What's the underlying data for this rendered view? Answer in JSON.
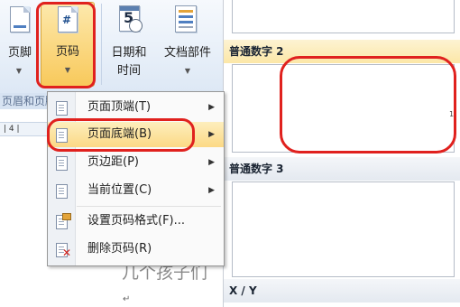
{
  "ribbon": {
    "buttons": [
      {
        "label": "页脚",
        "icon": "footer-icon"
      },
      {
        "label": "页码",
        "icon": "page-number-icon",
        "glyph": "#"
      },
      {
        "label_line1": "日期和",
        "label_line2": "时间",
        "icon": "calendar-clock-icon",
        "calendar_digit": "5"
      },
      {
        "label": "文档部件",
        "icon": "quick-parts-icon"
      }
    ],
    "group_label": "页眉和页脚",
    "ruler_text": "| 4 |"
  },
  "menu": {
    "items": [
      {
        "label": "页面顶端(T)",
        "submenu": true,
        "icon": "page-top-icon"
      },
      {
        "label": "页面底端(B)",
        "submenu": true,
        "icon": "page-bottom-icon"
      },
      {
        "label": "页边距(P)",
        "submenu": true,
        "icon": "page-margin-icon"
      },
      {
        "label": "当前位置(C)",
        "submenu": true,
        "icon": "current-position-icon"
      },
      {
        "label": "设置页码格式(F)...",
        "submenu": false,
        "icon": "format-page-number-icon"
      },
      {
        "label": "删除页码(R)",
        "submenu": false,
        "icon": "delete-page-number-icon"
      }
    ],
    "submenu_arrow": "▶",
    "active_index": 1
  },
  "gallery": {
    "item2_title": "普通数字 2",
    "item2_number": "1",
    "item3_title": "普通数字 3",
    "xy_title": "X / Y"
  },
  "document": {
    "background_text": "几个孩子们",
    "paragraph_mark": "↵"
  },
  "colors": {
    "annotation_red": "#e0211e",
    "menu_highlight": "#fcd985",
    "ribbon_bg": "#dde8f5"
  }
}
